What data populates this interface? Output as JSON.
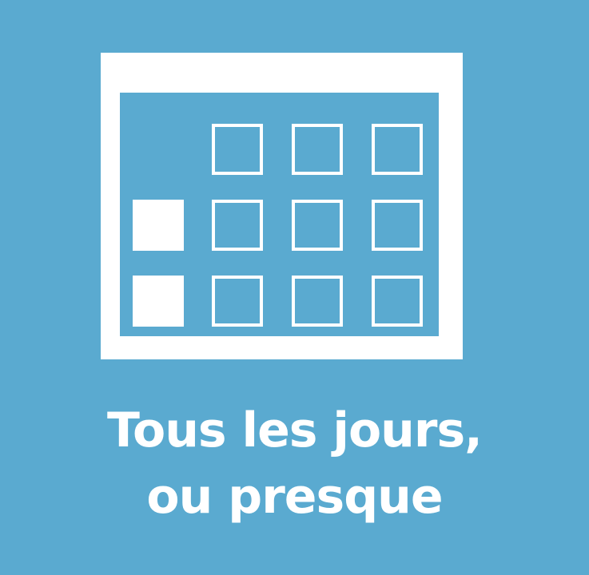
{
  "colors": {
    "background": "#5aaad0",
    "foreground": "#ffffff"
  },
  "icon": {
    "name": "calendar-icon",
    "grid": {
      "rows": 3,
      "columns": 4,
      "cells": [
        [
          "empty",
          "outline",
          "outline",
          "outline"
        ],
        [
          "filled",
          "outline",
          "outline",
          "outline"
        ],
        [
          "filled",
          "outline",
          "outline",
          "outline"
        ]
      ]
    }
  },
  "caption": {
    "line1": "Tous les jours,",
    "line2": "ou presque"
  }
}
